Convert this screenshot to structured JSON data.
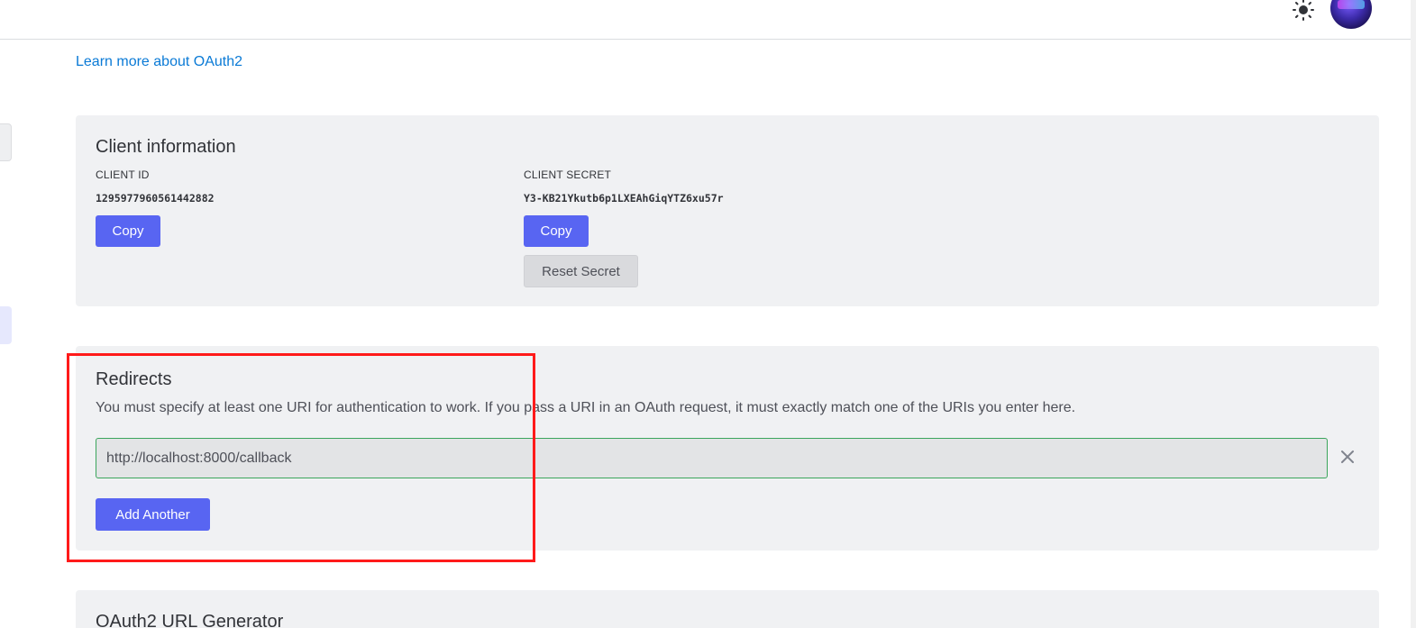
{
  "header": {
    "theme_icon": "sun-icon",
    "avatar_icon": "user-avatar"
  },
  "learn_more_link": "Learn more about OAuth2",
  "client_info": {
    "title": "Client information",
    "client_id_label": "CLIENT ID",
    "client_id_value": "1295977960561442882",
    "client_secret_label": "CLIENT SECRET",
    "client_secret_value": "Y3-KB21Ykutb6p1LXEAhGiqYTZ6xu57r",
    "copy_label": "Copy",
    "reset_label": "Reset Secret"
  },
  "redirects": {
    "title": "Redirects",
    "description": "You must specify at least one URI for authentication to work. If you pass a URI in an OAuth request, it must exactly match one of the URIs you enter here.",
    "uris": [
      "http://localhost:8000/callback"
    ],
    "remove_icon": "close-icon",
    "add_label": "Add Another"
  },
  "url_generator": {
    "title": "OAuth2 URL Generator"
  },
  "colors": {
    "primary": "#5865f2",
    "link": "#0a7ad6",
    "input_border_valid": "#3ba55c",
    "highlight": "#ff1a1a"
  }
}
